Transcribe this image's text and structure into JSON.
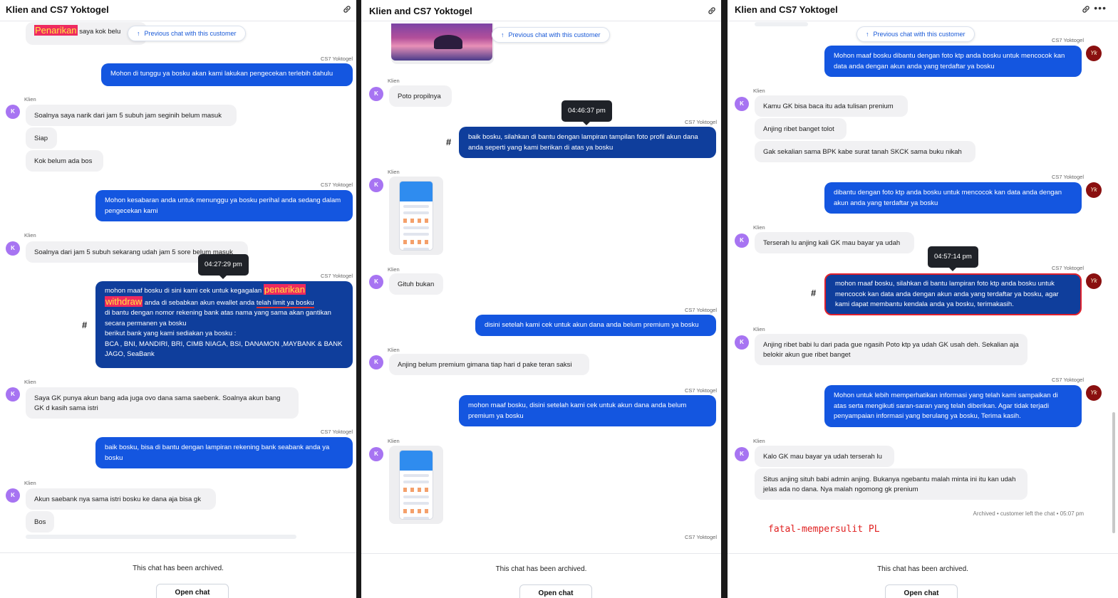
{
  "chat_title": "Klien and CS7 Yoktogel",
  "prev_chat_label": "Previous chat with this customer",
  "archived_text": "This chat has been archived.",
  "open_chat_label": "Open chat",
  "sender_cs": "CS7 Yoktogel",
  "sender_client": "Klien",
  "avatar_initial": "K",
  "avatar_cs_text": "Yk",
  "panel1": {
    "top_partial": {
      "highlight": "Penarikan",
      "rest": "saya kok belu"
    },
    "msg1": "Mohon di tunggu ya bosku akan kami lakukan pengecekan terlebih dahulu",
    "c1": "Soalnya saya narik dari jam 5 subuh jam seginih belum masuk",
    "c2": "Siap",
    "c3": "Kok belum ada bos",
    "msg2": "Mohon kesabaran anda untuk menunggu ya bosku perihal anda sedang dalam pengecekan kami",
    "c4": "Soalnya dari jam 5 subuh sekarang udah jam 5 sore belum masuk",
    "tooltip": "04:27:29 pm",
    "msg3": {
      "a": "mohon maaf bosku di sini kami cek untuk kegagalan ",
      "hl1": "penarikan",
      "hl2": "withdraw",
      "b": " anda di sebabkan akun ewallet anda ",
      "u": "telah limit ya bosku",
      "c": "di bantu dengan nomor rekening bank atas nama yang sama akan gantikan secara permanen ya bosku",
      "d": "berikut bank yang kami sediakan ya bosku :",
      "e": "BCA , BNI, MANDIRI, BRI, CIMB NIAGA, BSI, DANAMON ,MAYBANK & BANK JAGO, SeaBank"
    },
    "hash": "#",
    "c5": "Saya GK punya akun bang ada juga ovo dana sama saebenk. Soalnya akun bang GK d kasih sama istri",
    "msg4": "baik bosku, bisa di bantu dengan lampiran rekening bank seabank anda ya bosku",
    "c6": "Akun saebank nya sama istri bosku ke dana aja bisa gk",
    "c7": "Bos"
  },
  "panel2": {
    "c1": "Poto propilnya",
    "tooltip": "04:46:37 pm",
    "msg1": "baik bosku, silahkan di bantu dengan lampiran tampilan foto profil akun dana anda seperti yang kami berikan di atas ya bosku",
    "hash": "#",
    "c2": "Gituh bukan",
    "msg2": "disini setelah kami cek untuk akun dana anda belum premium ya bosku",
    "c3": "Anjing belum premium gimana tiap hari d pake teran saksi",
    "msg3": "mohon maaf bosku, disini setelah kami cek untuk akun dana anda belum premium ya bosku",
    "cut_label": "CS7 Yoktogel"
  },
  "panel3": {
    "msg1": "Mohon maaf bosku dibantu dengan foto ktp anda bosku untuk mencocok kan data anda dengan akun anda yang terdaftar ya bosku",
    "c1": "Kamu GK bisa baca itu ada tulisan prenium",
    "c2": "Anjing ribet banget tolot",
    "c3": "Gak sekalian sama BPK kabe surat tanah SKCK sama buku nikah",
    "msg2": "dibantu dengan foto ktp anda bosku untuk mencocok kan data anda dengan akun anda yang terdaftar ya bosku",
    "c4": "Terserah lu anjing kali GK mau bayar ya udah",
    "tooltip": "04:57:14 pm",
    "msg3": "mohon maaf bosku, silahkan di bantu lampiran foto ktp anda bosku untuk mencocok kan data anda dengan akun anda yang terdaftar ya bosku, agar kami dapat membantu kendala anda ya bosku, terimakasih.",
    "hash": "#",
    "c5": "Anjing ribet babi lu dari pada gue ngasih Poto ktp ya udah GK usah deh. Sekalian aja belokir akun gue ribet banget",
    "msg4": "Mohon untuk lebih memperhatikan informasi yang telah kami sampaikan di atas serta mengikuti saran-saran yang telah diberikan. Agar tidak terjadi penyampaian informasi yang berulang ya bosku, Terima kasih.",
    "c6": "Kalo GK mau bayar ya udah terserah lu",
    "c7": "Situs anjing situh babi admin anjing. Bukanya ngebantu malah minta ini itu kan udah jelas ada no dana. Nya malah ngomong gk prenium",
    "archived_line": "Archived • customer left the chat • 05:07 pm",
    "note": "fatal-mempersulit PL"
  }
}
